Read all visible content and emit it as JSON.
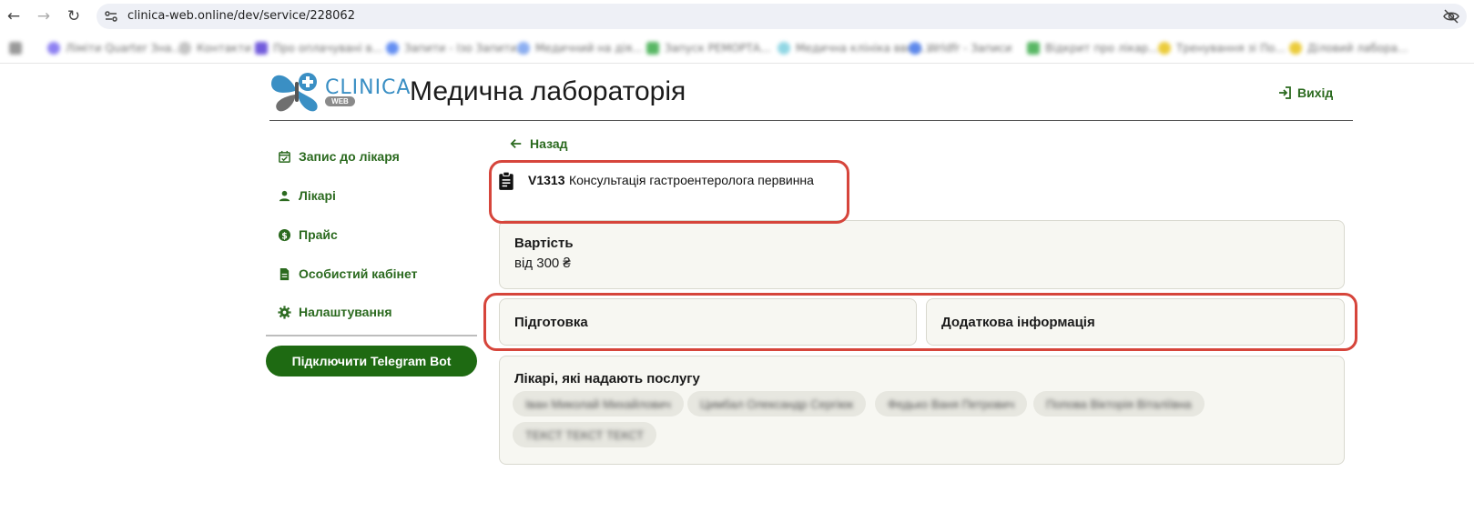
{
  "browser": {
    "url": "clinica-web.online/dev/service/228062",
    "bookmarks": [
      "Ліміти Quarter Зна...",
      "Контакти",
      "Про оплачувані в...",
      "Запити - Ізо Запити...",
      "Медичний на дія...",
      "Запуск РЕМОРТА...",
      "Медична клініка ввно...",
      "Wrldfr - Записи",
      "Відкрит про лікар...",
      "Тренування зі По...",
      "Діловий лабора..."
    ]
  },
  "header": {
    "logo_word": "CLINICA",
    "logo_badge": "WEB",
    "title": "Медична лабораторія",
    "logout_label": "Вихід"
  },
  "sidebar": {
    "items": [
      {
        "label": "Запис до лікаря",
        "icon": "calendar-check-icon"
      },
      {
        "label": "Лікарі",
        "icon": "person-icon"
      },
      {
        "label": "Прайс",
        "icon": "dollar-circle-icon"
      },
      {
        "label": "Особистий кабінет",
        "icon": "document-icon"
      },
      {
        "label": "Налаштування",
        "icon": "gear-icon"
      }
    ],
    "telegram_button": "Підключити Telegram Bot"
  },
  "main": {
    "back_label": "Назад",
    "service": {
      "code": "V1313",
      "name": "Консультація гастроентеролога первинна"
    },
    "price_card": {
      "title": "Вартість",
      "value": "від 300 ₴"
    },
    "preparation_title": "Підготовка",
    "additional_info_title": "Додаткова інформація",
    "doctors_card": {
      "title": "Лікарі, які надають послугу",
      "doctors": [
        "Іван Миколай Михайлович",
        "Цимбал Олександр Сергіюк",
        "Федько Ваня Петрович",
        "Попова Вікторія Віталіївна",
        "ТЕКСТ ТЕКСТ ТЕКСТ"
      ]
    }
  },
  "colors": {
    "accent_green": "#2b6a1f",
    "button_green": "#1e6a12",
    "annotation_red": "#d6453b",
    "card_bg": "#f7f7f2"
  }
}
